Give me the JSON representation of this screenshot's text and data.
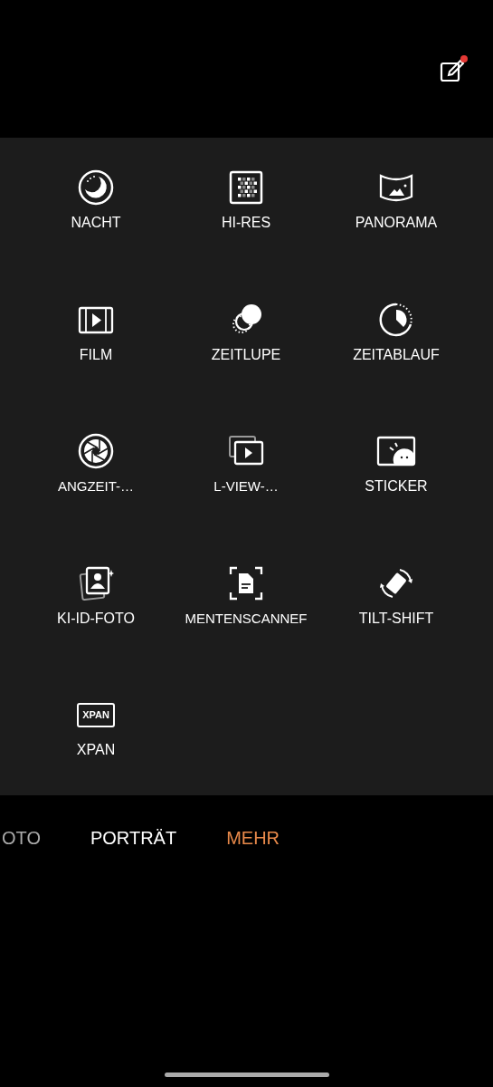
{
  "top_bar": {
    "edit_button": {
      "badge": true
    }
  },
  "modes_grid": [
    {
      "kind": "night",
      "label": "NACHT"
    },
    {
      "kind": "hires",
      "label": "HI-RES"
    },
    {
      "kind": "panorama",
      "label": "PANORAMA"
    },
    {
      "kind": "film",
      "label": "FILM"
    },
    {
      "kind": "slowmo",
      "label": "ZEITLUPE"
    },
    {
      "kind": "timelapse",
      "label": "ZEITABLAUF"
    },
    {
      "kind": "aperture",
      "label": "ANGZEIT-…"
    },
    {
      "kind": "dualview",
      "label": "L-VIEW-…"
    },
    {
      "kind": "sticker",
      "label": "STICKER"
    },
    {
      "kind": "idphoto",
      "label": "KI-ID-FOTO"
    },
    {
      "kind": "docscan",
      "label": "MENTENSCANNEF"
    },
    {
      "kind": "tiltshift",
      "label": "TILT-SHIFT"
    },
    {
      "kind": "xpan",
      "label": "XPAN",
      "icon_text": "XPAN"
    }
  ],
  "mode_bar": [
    {
      "label": "OTO",
      "selected": false
    },
    {
      "label": "PORTRÄT",
      "selected": false
    },
    {
      "label": "MEHR",
      "selected": true
    }
  ]
}
